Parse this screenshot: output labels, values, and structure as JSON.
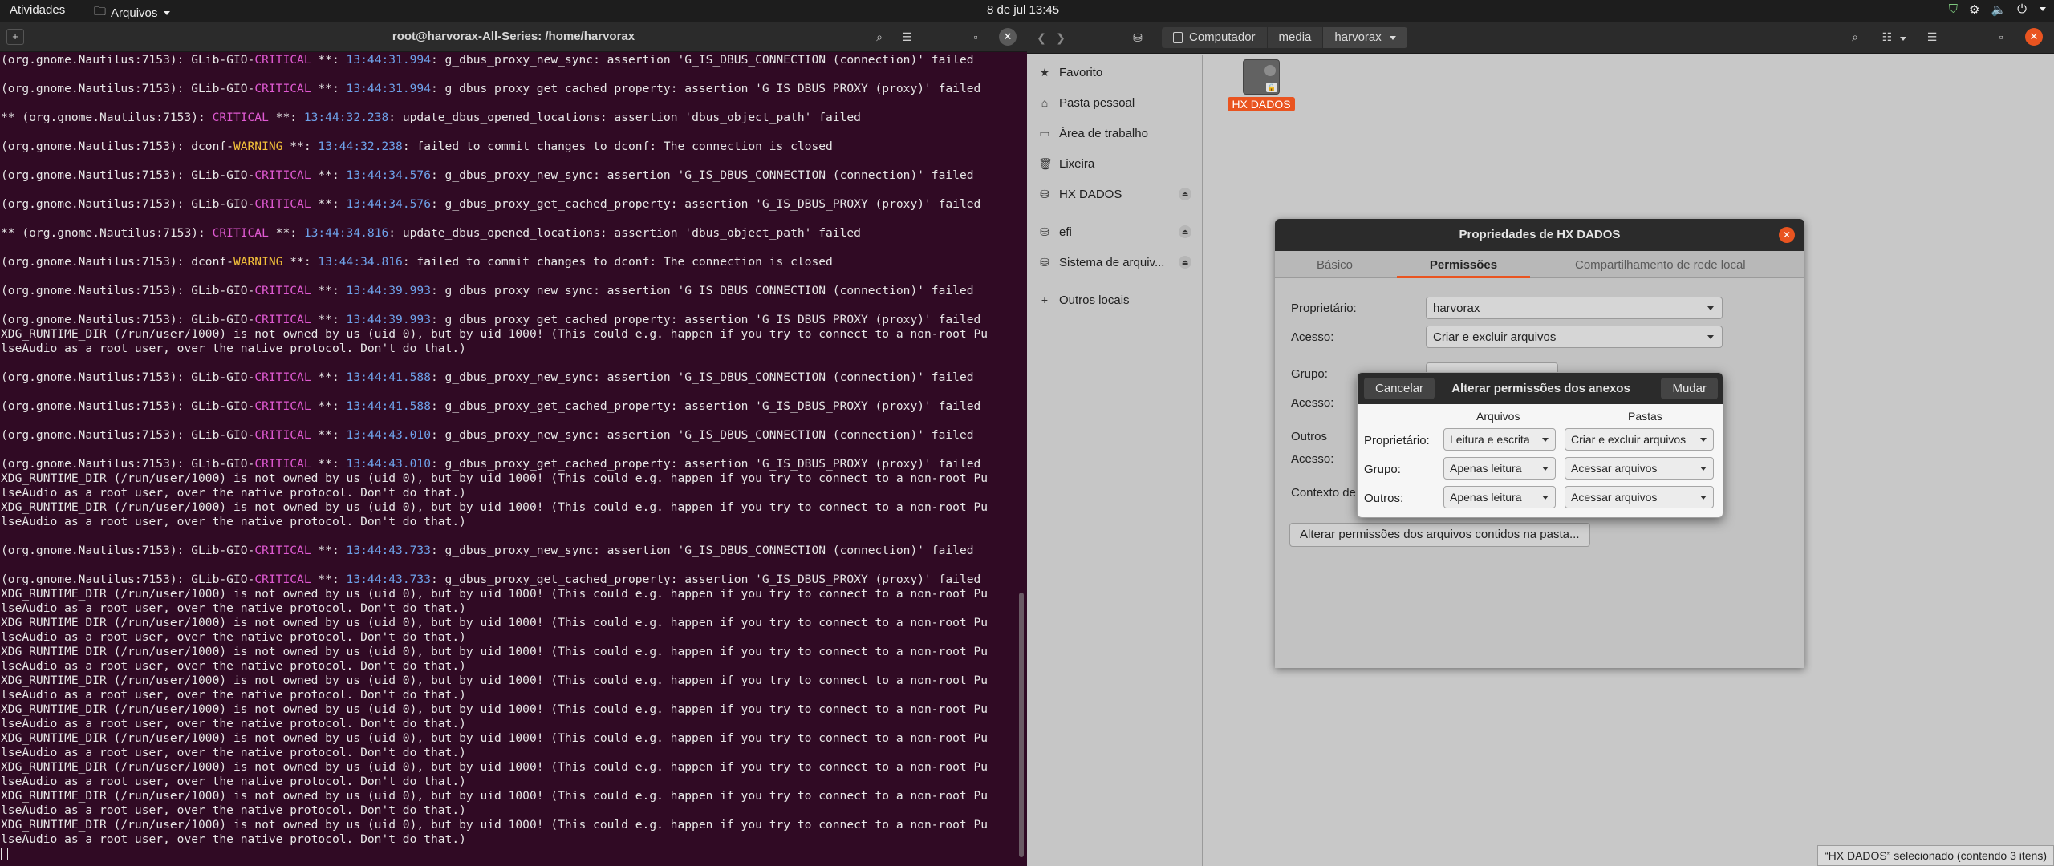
{
  "topbar": {
    "activities": "Atividades",
    "app_menu": "Arquivos",
    "clock": "8 de jul  13:45",
    "tray_icons": [
      "shield-icon",
      "network-icon",
      "volume-icon",
      "power-icon"
    ]
  },
  "terminal": {
    "title": "root@harvorax-All-Series: /home/harvorax",
    "lines": [
      [
        "(org.gnome.Nautilus:7153): GLib-GIO-",
        "CRITICAL",
        "crit",
        " **: ",
        "13:44:31.994",
        ": g_dbus_proxy_new_sync: assertion 'G_IS_DBUS_CONNECTION (connection)' failed"
      ],
      [
        ""
      ],
      [
        "(org.gnome.Nautilus:7153): GLib-GIO-",
        "CRITICAL",
        "crit",
        " **: ",
        "13:44:31.994",
        ": g_dbus_proxy_get_cached_property: assertion 'G_IS_DBUS_PROXY (proxy)' failed"
      ],
      [
        ""
      ],
      [
        "** (org.gnome.Nautilus:7153): ",
        "CRITICAL",
        "crit",
        " **: ",
        "13:44:32.238",
        ": update_dbus_opened_locations: assertion 'dbus_object_path' failed"
      ],
      [
        ""
      ],
      [
        "(org.gnome.Nautilus:7153): dconf-",
        "WARNING",
        "warn",
        " **: ",
        "13:44:32.238",
        ": failed to commit changes to dconf: The connection is closed"
      ],
      [
        ""
      ],
      [
        "(org.gnome.Nautilus:7153): GLib-GIO-",
        "CRITICAL",
        "crit",
        " **: ",
        "13:44:34.576",
        ": g_dbus_proxy_new_sync: assertion 'G_IS_DBUS_CONNECTION (connection)' failed"
      ],
      [
        ""
      ],
      [
        "(org.gnome.Nautilus:7153): GLib-GIO-",
        "CRITICAL",
        "crit",
        " **: ",
        "13:44:34.576",
        ": g_dbus_proxy_get_cached_property: assertion 'G_IS_DBUS_PROXY (proxy)' failed"
      ],
      [
        ""
      ],
      [
        "** (org.gnome.Nautilus:7153): ",
        "CRITICAL",
        "crit",
        " **: ",
        "13:44:34.816",
        ": update_dbus_opened_locations: assertion 'dbus_object_path' failed"
      ],
      [
        ""
      ],
      [
        "(org.gnome.Nautilus:7153): dconf-",
        "WARNING",
        "warn",
        " **: ",
        "13:44:34.816",
        ": failed to commit changes to dconf: The connection is closed"
      ],
      [
        ""
      ],
      [
        "(org.gnome.Nautilus:7153): GLib-GIO-",
        "CRITICAL",
        "crit",
        " **: ",
        "13:44:39.993",
        ": g_dbus_proxy_new_sync: assertion 'G_IS_DBUS_CONNECTION (connection)' failed"
      ],
      [
        ""
      ],
      [
        "(org.gnome.Nautilus:7153): GLib-GIO-",
        "CRITICAL",
        "crit",
        " **: ",
        "13:44:39.993",
        ": g_dbus_proxy_get_cached_property: assertion 'G_IS_DBUS_PROXY (proxy)' failed"
      ],
      [
        "XDG_RUNTIME_DIR (/run/user/1000) is not owned by us (uid 0), but by uid 1000! (This could e.g. happen if you try to connect to a non-root Pu"
      ],
      [
        "lseAudio as a root user, over the native protocol. Don't do that.)"
      ],
      [
        ""
      ],
      [
        "(org.gnome.Nautilus:7153): GLib-GIO-",
        "CRITICAL",
        "crit",
        " **: ",
        "13:44:41.588",
        ": g_dbus_proxy_new_sync: assertion 'G_IS_DBUS_CONNECTION (connection)' failed"
      ],
      [
        ""
      ],
      [
        "(org.gnome.Nautilus:7153): GLib-GIO-",
        "CRITICAL",
        "crit",
        " **: ",
        "13:44:41.588",
        ": g_dbus_proxy_get_cached_property: assertion 'G_IS_DBUS_PROXY (proxy)' failed"
      ],
      [
        ""
      ],
      [
        "(org.gnome.Nautilus:7153): GLib-GIO-",
        "CRITICAL",
        "crit",
        " **: ",
        "13:44:43.010",
        ": g_dbus_proxy_new_sync: assertion 'G_IS_DBUS_CONNECTION (connection)' failed"
      ],
      [
        ""
      ],
      [
        "(org.gnome.Nautilus:7153): GLib-GIO-",
        "CRITICAL",
        "crit",
        " **: ",
        "13:44:43.010",
        ": g_dbus_proxy_get_cached_property: assertion 'G_IS_DBUS_PROXY (proxy)' failed"
      ],
      [
        "XDG_RUNTIME_DIR (/run/user/1000) is not owned by us (uid 0), but by uid 1000! (This could e.g. happen if you try to connect to a non-root Pu"
      ],
      [
        "lseAudio as a root user, over the native protocol. Don't do that.)"
      ],
      [
        "XDG_RUNTIME_DIR (/run/user/1000) is not owned by us (uid 0), but by uid 1000! (This could e.g. happen if you try to connect to a non-root Pu"
      ],
      [
        "lseAudio as a root user, over the native protocol. Don't do that.)"
      ],
      [
        ""
      ],
      [
        "(org.gnome.Nautilus:7153): GLib-GIO-",
        "CRITICAL",
        "crit",
        " **: ",
        "13:44:43.733",
        ": g_dbus_proxy_new_sync: assertion 'G_IS_DBUS_CONNECTION (connection)' failed"
      ],
      [
        ""
      ],
      [
        "(org.gnome.Nautilus:7153): GLib-GIO-",
        "CRITICAL",
        "crit",
        " **: ",
        "13:44:43.733",
        ": g_dbus_proxy_get_cached_property: assertion 'G_IS_DBUS_PROXY (proxy)' failed"
      ],
      [
        "XDG_RUNTIME_DIR (/run/user/1000) is not owned by us (uid 0), but by uid 1000! (This could e.g. happen if you try to connect to a non-root Pu"
      ],
      [
        "lseAudio as a root user, over the native protocol. Don't do that.)"
      ],
      [
        "XDG_RUNTIME_DIR (/run/user/1000) is not owned by us (uid 0), but by uid 1000! (This could e.g. happen if you try to connect to a non-root Pu"
      ],
      [
        "lseAudio as a root user, over the native protocol. Don't do that.)"
      ],
      [
        "XDG_RUNTIME_DIR (/run/user/1000) is not owned by us (uid 0), but by uid 1000! (This could e.g. happen if you try to connect to a non-root Pu"
      ],
      [
        "lseAudio as a root user, over the native protocol. Don't do that.)"
      ],
      [
        "XDG_RUNTIME_DIR (/run/user/1000) is not owned by us (uid 0), but by uid 1000! (This could e.g. happen if you try to connect to a non-root Pu"
      ],
      [
        "lseAudio as a root user, over the native protocol. Don't do that.)"
      ],
      [
        "XDG_RUNTIME_DIR (/run/user/1000) is not owned by us (uid 0), but by uid 1000! (This could e.g. happen if you try to connect to a non-root Pu"
      ],
      [
        "lseAudio as a root user, over the native protocol. Don't do that.)"
      ],
      [
        "XDG_RUNTIME_DIR (/run/user/1000) is not owned by us (uid 0), but by uid 1000! (This could e.g. happen if you try to connect to a non-root Pu"
      ],
      [
        "lseAudio as a root user, over the native protocol. Don't do that.)"
      ],
      [
        "XDG_RUNTIME_DIR (/run/user/1000) is not owned by us (uid 0), but by uid 1000! (This could e.g. happen if you try to connect to a non-root Pu"
      ],
      [
        "lseAudio as a root user, over the native protocol. Don't do that.)"
      ],
      [
        "XDG_RUNTIME_DIR (/run/user/1000) is not owned by us (uid 0), but by uid 1000! (This could e.g. happen if you try to connect to a non-root Pu"
      ],
      [
        "lseAudio as a root user, over the native protocol. Don't do that.)"
      ],
      [
        "XDG_RUNTIME_DIR (/run/user/1000) is not owned by us (uid 0), but by uid 1000! (This could e.g. happen if you try to connect to a non-root Pu"
      ],
      [
        "lseAudio as a root user, over the native protocol. Don't do that.)"
      ]
    ],
    "colors": {
      "background": "#300a24",
      "critical": "#e05ad2",
      "warning": "#f3c13a",
      "timestamp": "#6ea2ea"
    }
  },
  "files": {
    "path": [
      "Computador",
      "media",
      "harvorax"
    ],
    "sidebar": {
      "items": [
        {
          "label": "Favorito",
          "icon": "star-icon"
        },
        {
          "label": "Pasta pessoal",
          "icon": "home-icon"
        },
        {
          "label": "Área de trabalho",
          "icon": "desktop-icon"
        },
        {
          "label": "Lixeira",
          "icon": "trash-icon"
        },
        {
          "label": "HX DADOS",
          "icon": "drive-icon"
        },
        {
          "label": "efi",
          "icon": "drive-icon"
        },
        {
          "label": "Sistema de arquiv...",
          "icon": "drive-icon"
        },
        {
          "label": "Outros locais",
          "icon": "plus-icon"
        }
      ]
    },
    "selected_item": "HX DADOS",
    "status": "“HX DADOS” selecionado  (contendo 3 itens)",
    "accent": "#e95420"
  },
  "properties": {
    "title": "Propriedades de HX DADOS",
    "tabs": [
      "Básico",
      "Permissões",
      "Compartilhamento de rede local"
    ],
    "active_tab": "Permissões",
    "owner_label": "Proprietário:",
    "owner_value": "harvorax",
    "access_label": "Acesso:",
    "access_value": "Criar e excluir arquivos",
    "group_label": "Grupo:",
    "group_access_label": "Acesso:",
    "others_label": "Outros",
    "others_access_label": "Acesso:",
    "context_label": "Contexto de",
    "change_contents_button": "Alterar permissões dos arquivos contidos na pasta..."
  },
  "subdialog": {
    "title": "Alterar permissões dos anexos",
    "cancel": "Cancelar",
    "apply": "Mudar",
    "col_files": "Arquivos",
    "col_folders": "Pastas",
    "rows": [
      {
        "label": "Proprietário:",
        "files": "Leitura e escrita",
        "folders": "Criar e excluir arquivos"
      },
      {
        "label": "Grupo:",
        "files": "Apenas leitura",
        "folders": "Acessar arquivos"
      },
      {
        "label": "Outros:",
        "files": "Apenas leitura",
        "folders": "Acessar arquivos"
      }
    ]
  }
}
